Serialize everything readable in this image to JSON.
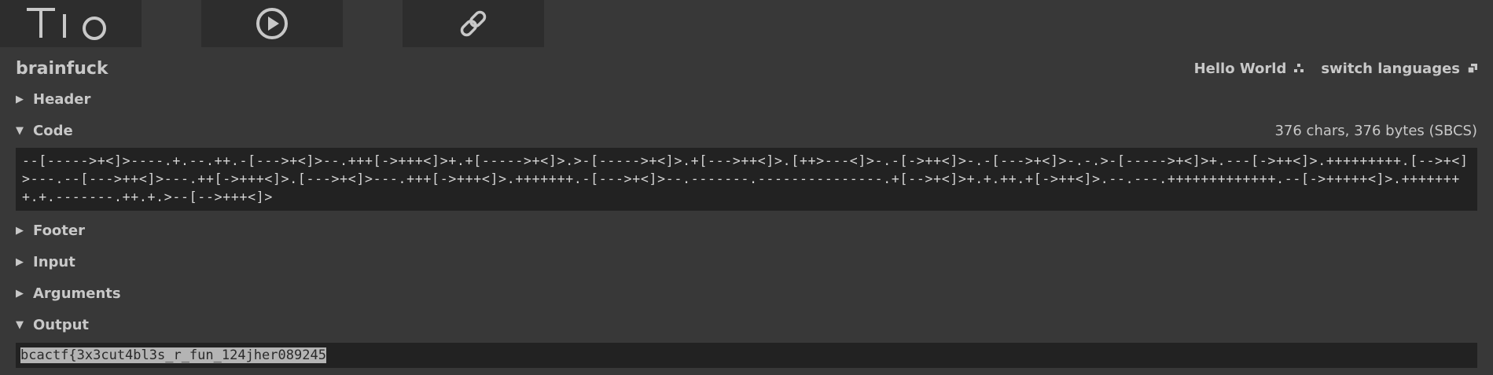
{
  "toolbar": {
    "logo_text": "TIO",
    "run_icon": "play-circle-icon",
    "link_icon": "chain-link-icon"
  },
  "language": {
    "name": "brainfuck",
    "hello_world": "Hello World",
    "switch_languages": "switch languages"
  },
  "sections": {
    "header": {
      "label": "Header",
      "expanded": false
    },
    "code": {
      "label": "Code",
      "expanded": true,
      "counter": "376 chars, 376 bytes (SBCS)"
    },
    "footer": {
      "label": "Footer",
      "expanded": false
    },
    "input": {
      "label": "Input",
      "expanded": false
    },
    "arguments": {
      "label": "Arguments",
      "expanded": false
    },
    "output": {
      "label": "Output",
      "expanded": true
    }
  },
  "code": "--[----->+<]>----.+.--.++.-[--->+<]>--.+++[->+++<]>+.+[----->+<]>.>-[----->+<]>.+[--->++<]>.[++>---<]>-.-[->++<]>-.-[--->+<]>-.-.>-[----->+<]>+.---[->++<]>.+++++++++.[-->+<]>---.--[--->++<]>---.++[->+++<]>.[--->+<]>---.+++[->+++<]>.+++++++.-[--->+<]>--.-------.---------------.+[-->+<]>+.+.++.+[->++<]>.--.---.+++++++++++++.--[->+++++<]>.++++++++.+.-------.++.+.>--[-->+++<]>",
  "output": "bcactf{3x3cut4bl3s_r_fun_124jher089245",
  "colors": {
    "background": "#383838",
    "toolbar_button": "#2d2d2d",
    "code_background": "#222222",
    "text": "#c8c8c8",
    "selection": "#b4b4b4"
  }
}
